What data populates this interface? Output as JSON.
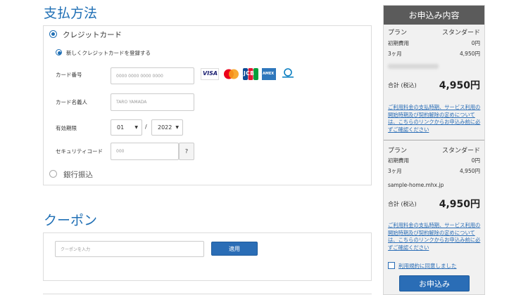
{
  "payment": {
    "title": "支払方法",
    "credit_label": "クレジットカード",
    "new_card_label": "新しくクレジットカードを登録する",
    "card_number_label": "カード番号",
    "card_number_placeholder": "0000 0000 0000 0000",
    "card_name_label": "カード名義人",
    "card_name_placeholder": "TARO YAMADA",
    "expiry_label": "有効期限",
    "expiry_month": "01",
    "expiry_sep": "/",
    "expiry_year": "2022",
    "security_label": "セキュリティコード",
    "security_placeholder": "000",
    "security_help": "?",
    "bank_label": "銀行振込",
    "brands": [
      "VISA",
      "Mastercard",
      "JCB",
      "American Express",
      "Diners Club"
    ],
    "brand_visa_text": "VISA",
    "brand_jcb_text": "JCB",
    "brand_amex_text": "AMEX"
  },
  "coupon": {
    "title": "クーポン",
    "placeholder": "クーポンを入力",
    "apply_label": "適用"
  },
  "summary": {
    "title": "お申込み内容",
    "plan_label": "プラン",
    "plan_value": "スタンダード",
    "initial_label": "初期費用",
    "initial_value": "0円",
    "period_label": "3ヶ月",
    "period_value": "4,950円",
    "total_label": "合計 (税込)",
    "total_value": "4,950円",
    "note": "ご利用料金の支払時期、サービス利用の開始時期及び契約解除の定めについては、こちらのリンクからお申込み前に必ずご確認ください",
    "domain": "sample-home.mhx.jp",
    "plan2_label": "プラン",
    "plan2_value": "スタンダード",
    "initial2_label": "初期費用",
    "initial2_value": "0円",
    "period2_label": "3ヶ月",
    "period2_value": "4,950円",
    "total2_label": "合計 (税込)",
    "total2_value": "4,950円",
    "note2": "ご利用料金の支払時期、サービス利用の開始時期及び契約解除の定めについては、こちらのリンクからお申込み前に必ずご確認ください",
    "agree_label": "利用規約に同意しました",
    "submit_label": "お申込み"
  },
  "colors": {
    "accent": "#1f6fb5",
    "button": "#2a6db6",
    "sidebar_head": "#5b5b5b"
  }
}
